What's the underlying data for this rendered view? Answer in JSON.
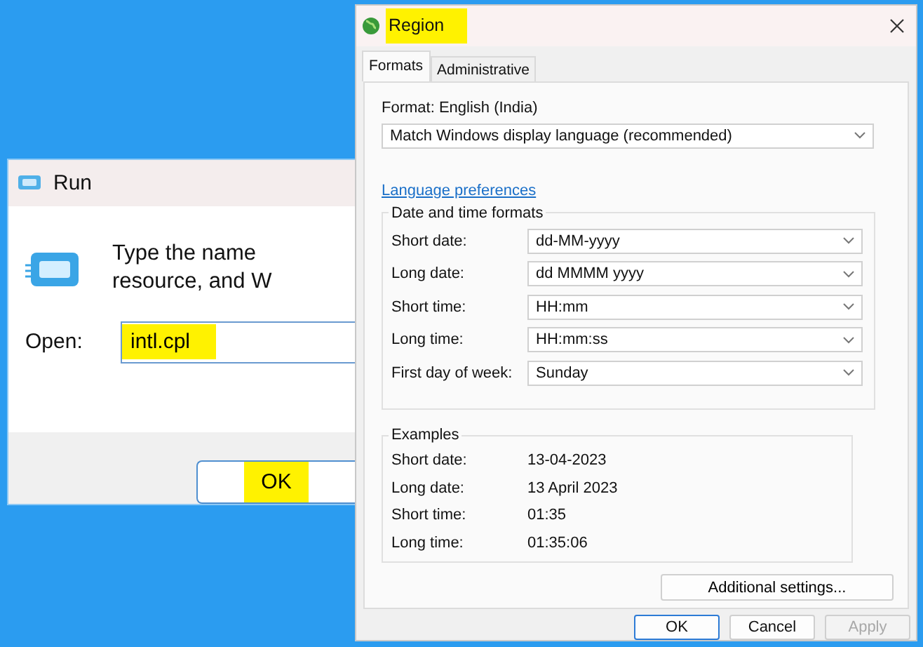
{
  "run_dialog": {
    "title": "Run",
    "description": [
      "Type the name",
      "resource, and W"
    ],
    "open_label": "Open:",
    "open_value": "intl.cpl",
    "open_highlighted": true,
    "ok_button": {
      "label": "OK",
      "highlighted": true
    }
  },
  "region_dialog": {
    "title": "Region",
    "title_highlighted": true,
    "tabs": [
      {
        "label": "Formats",
        "selected": true
      },
      {
        "label": "Administrative",
        "selected": false
      }
    ],
    "format_label": "Format: English (India)",
    "format_value": "Match Windows display language (recommended)",
    "link": "Language preferences",
    "date_time_formats": {
      "title": "Date and time formats",
      "rows": [
        {
          "label": "Short date:",
          "value": "dd-MM-yyyy"
        },
        {
          "label": "Long date:",
          "value": "dd MMMM yyyy"
        },
        {
          "label": "Short time:",
          "value": "HH:mm"
        },
        {
          "label": "Long time:",
          "value": "HH:mm:ss"
        },
        {
          "label": "First day of week:",
          "value": "Sunday"
        }
      ]
    },
    "examples": {
      "title": "Examples",
      "rows": [
        {
          "label": "Short date:",
          "value": "13-04-2023"
        },
        {
          "label": "Long date:",
          "value": "13 April 2023"
        },
        {
          "label": "Short time:",
          "value": "01:35"
        },
        {
          "label": "Long time:",
          "value": "01:35:06"
        }
      ]
    },
    "additional_button": "Additional settings...",
    "buttons": [
      {
        "label": "OK",
        "default": true,
        "disabled": false
      },
      {
        "label": "Cancel",
        "default": false,
        "disabled": false
      },
      {
        "label": "Apply",
        "default": false,
        "disabled": true
      }
    ]
  }
}
